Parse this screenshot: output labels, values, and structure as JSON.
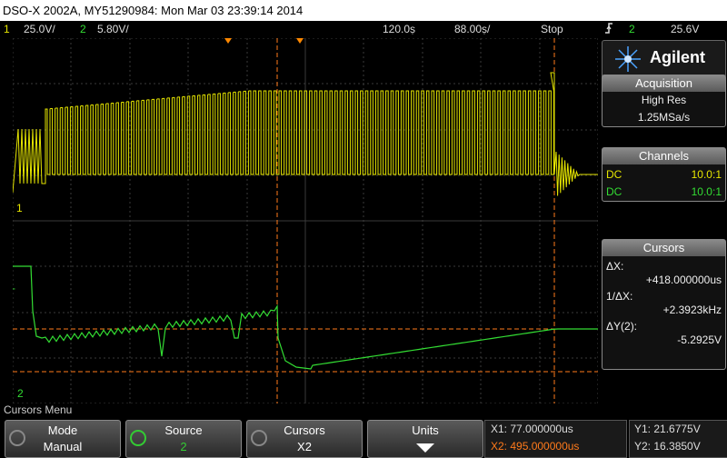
{
  "title_bar": "DSO-X 2002A, MY51290984: Mon Mar 03 23:39:14 2014",
  "status": {
    "ch1_num": "1",
    "ch1_scale": "25.0V/",
    "ch2_num": "2",
    "ch2_scale": "5.80V/",
    "time_scale": "120.0ṣ",
    "delay": "88.00ṣ/",
    "run_state": "Stop",
    "trigger_icon": "trigger-edge-icon",
    "trigger_source": "2",
    "trigger_level": "25.6V"
  },
  "brand": "Agilent",
  "acquisition": {
    "header": "Acquisition",
    "mode": "High Res",
    "rate": "1.25MSa/s"
  },
  "channels": {
    "header": "Channels",
    "ch1_coupling": "DC",
    "ch1_probe": "10.0:1",
    "ch2_coupling": "DC",
    "ch2_probe": "10.0:1"
  },
  "cursors": {
    "header": "Cursors",
    "dx_label": "ΔX:",
    "dx_value": "+418.000000us",
    "inv_dx_label": "1/ΔX:",
    "inv_dx_value": "+2.3923kHz",
    "dy_label": "ΔY(2):",
    "dy_value": "-5.2925V"
  },
  "menu_title": "Cursors Menu",
  "softkeys": {
    "mode_label": "Mode",
    "mode_value": "Manual",
    "source_label": "Source",
    "source_value": "2",
    "cursors_label": "Cursors",
    "cursors_value": "X2",
    "units_label": "Units"
  },
  "cursor_values": {
    "x1": "X1: 77.000000us",
    "x2": "X2: 495.000000us",
    "y1": "Y1: 21.6775V",
    "y2": "Y2: 16.3850V"
  },
  "markers": {
    "ch1_ground": "1",
    "ch2_ground": "2",
    "trigger_marker": "T"
  },
  "colors": {
    "ch1": "#e6e600",
    "ch2": "#33dd33",
    "cursor": "#ff7a1a",
    "panel_accent": "#ff8800"
  }
}
